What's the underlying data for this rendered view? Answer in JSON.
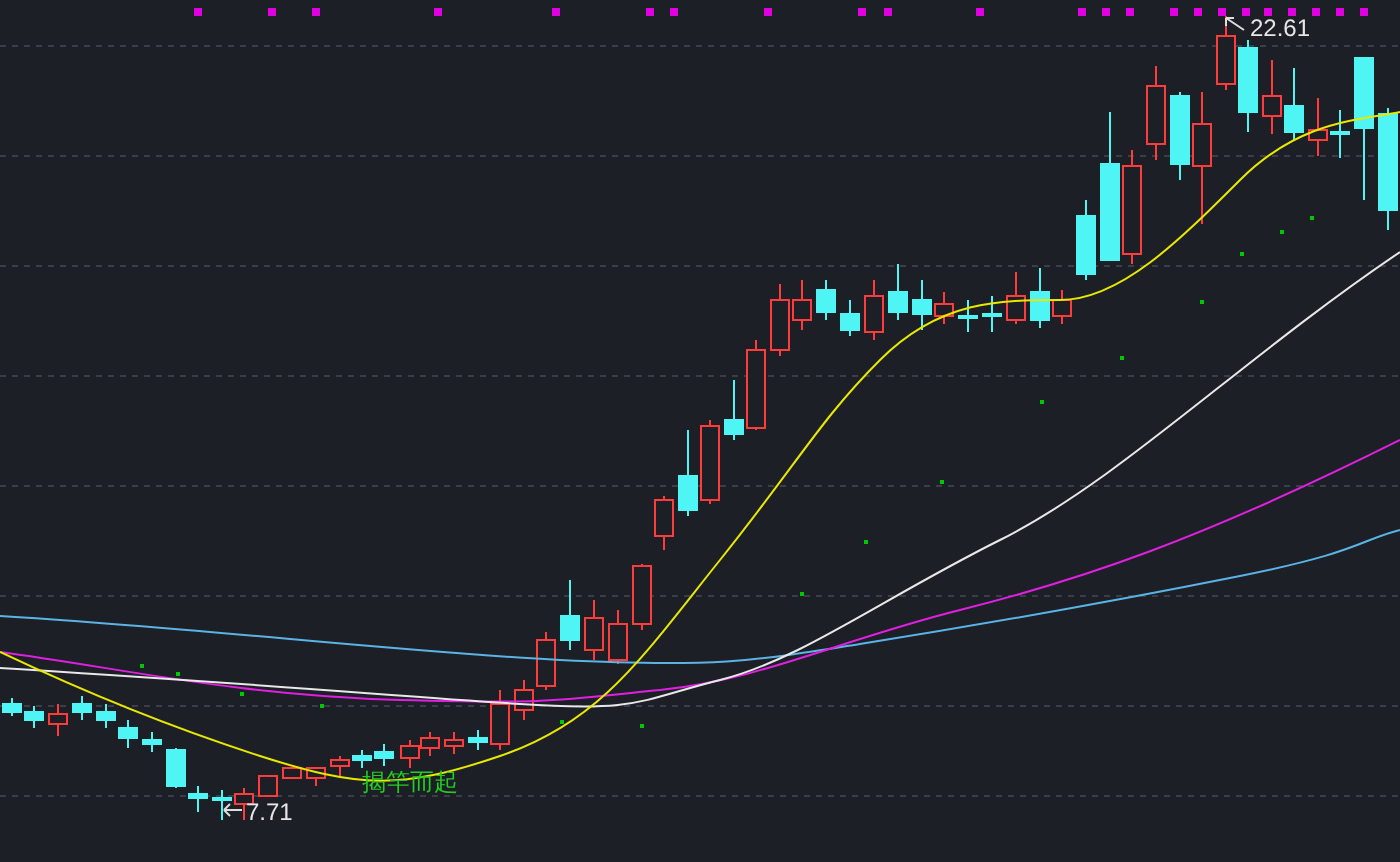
{
  "chart": {
    "high_label": "22.61",
    "low_label": "7.71",
    "annotation": "揭竿而起"
  }
}
